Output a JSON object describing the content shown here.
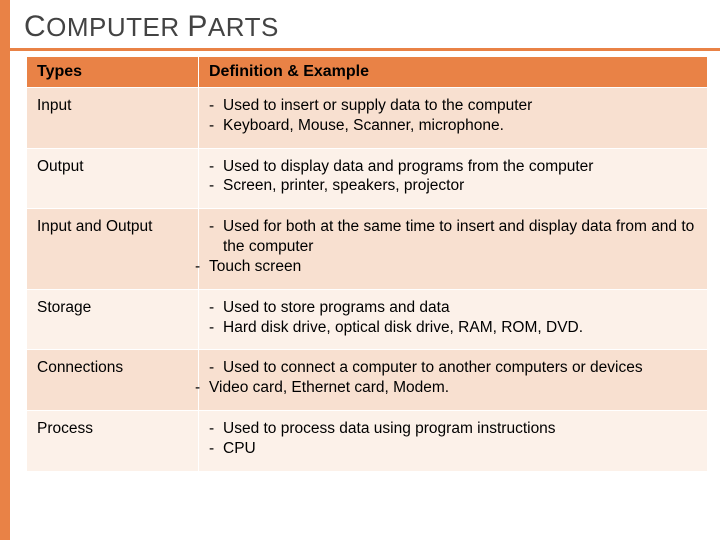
{
  "title_parts": {
    "c1": "C",
    "w1": "OMPUTER ",
    "c2": "P",
    "w2": "ARTS"
  },
  "headers": {
    "col0": "Types",
    "col1": "Definition & Example"
  },
  "rows": [
    {
      "type": "Input",
      "lines": [
        {
          "outdent": false,
          "text": "Used to insert or supply data to the computer"
        },
        {
          "outdent": false,
          "text": "Keyboard, Mouse, Scanner, microphone."
        }
      ]
    },
    {
      "type": "Output",
      "lines": [
        {
          "outdent": false,
          "text": "Used to display data and programs from the computer"
        },
        {
          "outdent": false,
          "text": "Screen, printer, speakers, projector"
        }
      ]
    },
    {
      "type": "Input and Output",
      "lines": [
        {
          "outdent": false,
          "text": "Used for both at the same time to  insert and display data from and to the computer"
        },
        {
          "outdent": true,
          "text": "Touch screen"
        }
      ]
    },
    {
      "type": "Storage",
      "lines": [
        {
          "outdent": false,
          "text": "Used to store programs and data"
        },
        {
          "outdent": false,
          "text": "Hard disk drive, optical disk drive, RAM, ROM, DVD."
        }
      ]
    },
    {
      "type": "Connections",
      "lines": [
        {
          "outdent": false,
          "text": "Used to connect a computer to another computers or devices"
        },
        {
          "outdent": true,
          "text": "Video card, Ethernet card, Modem."
        }
      ]
    },
    {
      "type": "Process",
      "lines": [
        {
          "outdent": false,
          "text": "Used to process data using program instructions"
        },
        {
          "outdent": false,
          "text": "CPU"
        }
      ]
    }
  ],
  "chart_data": {
    "type": "table",
    "title": "COMPUTER PARTS",
    "columns": [
      "Types",
      "Definition & Example"
    ],
    "rows": [
      [
        "Input",
        "Used to insert or supply data to the computer; Keyboard, Mouse, Scanner, microphone."
      ],
      [
        "Output",
        "Used to display data and programs from the computer; Screen, printer, speakers, projector"
      ],
      [
        "Input and Output",
        "Used for both at the same time to insert and display data from and to the computer; Touch screen"
      ],
      [
        "Storage",
        "Used to store programs and data; Hard disk drive, optical disk drive, RAM, ROM, DVD."
      ],
      [
        "Connections",
        "Used to connect a computer to another computers or devices; Video card, Ethernet card, Modem."
      ],
      [
        "Process",
        "Used to process data using program instructions; CPU"
      ]
    ]
  }
}
